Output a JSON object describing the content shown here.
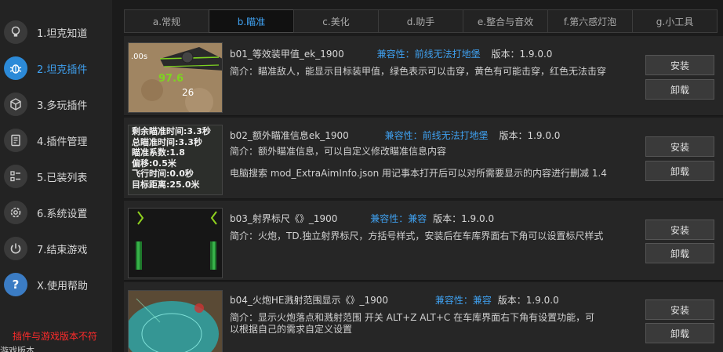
{
  "sidebar": {
    "items": [
      {
        "label": "1.坦克知道",
        "icon": "lightbulb-icon"
      },
      {
        "label": "2.坦克插件",
        "icon": "bug-icon"
      },
      {
        "label": "3.多玩插件",
        "icon": "cube-icon"
      },
      {
        "label": "4.插件管理",
        "icon": "document-icon"
      },
      {
        "label": "5.已装列表",
        "icon": "list-icon"
      },
      {
        "label": "6.系统设置",
        "icon": "gear-icon"
      },
      {
        "label": "7.结束游戏",
        "icon": "power-icon"
      },
      {
        "label": "X.使用帮助",
        "icon": "help-icon"
      }
    ],
    "warning": "插件与游戏版本不符",
    "warning2": "游戏版本"
  },
  "tabs": [
    "a.常规",
    "b.瞄准",
    "c.美化",
    "d.助手",
    "e.整合与音效",
    "f.第六感灯泡",
    "g.小工具"
  ],
  "active_tab": "b.瞄准",
  "plugins": [
    {
      "name": "b01_等效装甲值_ek_1900",
      "compat": "兼容性：前线无法打地堡",
      "version": "版本：1.9.0.0",
      "desc": "简介：瞄准敌人，能显示目标装甲值，绿色表示可以击穿，黄色有可能击穿，红色无法击穿",
      "desc2": "",
      "thumb_texts": [
        ".00s",
        "97.6",
        "26"
      ]
    },
    {
      "name": "b02_额外瞄准信息ek_1900",
      "compat": "兼容性：前线无法打地堡",
      "version": "版本：1.9.0.0",
      "desc": "简介：额外瞄准信息，可以自定义修改瞄准信息内容",
      "desc2": "电脑搜索 mod_ExtraAimInfo.json 用记事本打开后可以对所需要显示的内容进行删减 1.4",
      "thumb_lines": [
        "剩余瞄准时间:3.3秒",
        "总瞄准时间:3.3秒",
        "瞄准系数:1.8",
        "偏移:0.5米",
        "飞行时间:0.0秒",
        "目标距离:25.0米"
      ]
    },
    {
      "name": "b03_射界标尺《》_1900",
      "compat": "兼容性：兼容",
      "version": "版本：1.9.0.0",
      "desc": "简介：火炮，TD.独立射界标尺，方括号样式，安装后在车库界面右下角可以设置标尺样式",
      "desc2": ""
    },
    {
      "name": "b04_火炮HE溅射范围显示《》_1900",
      "compat": "兼容性：兼容",
      "version": "版本：1.9.0.0",
      "desc": "简介：显示火炮落点和溅射范围 开关 ALT+Z  ALT+C 在车库界面右下角有设置功能，可以根据自己的需求自定义设置",
      "desc2": ""
    }
  ],
  "buttons": {
    "install": "安装",
    "uninstall": "卸载"
  },
  "colors": {
    "accent": "#3fa0ef",
    "warning": "#ff2b2b",
    "active_nav": "#2c8ad8"
  }
}
